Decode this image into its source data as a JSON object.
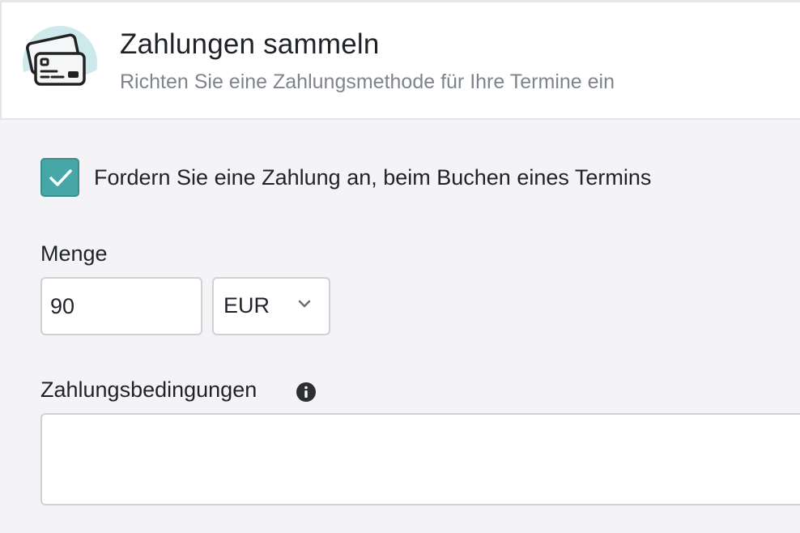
{
  "header": {
    "title": "Zahlungen sammeln",
    "subtitle": "Richten Sie eine Zahlungsmethode für Ihre Termine ein",
    "icon": "credit-cards-icon"
  },
  "payment_required": {
    "checked": true,
    "label": "Fordern Sie eine Zahlung an, beim Buchen eines Termins"
  },
  "amount": {
    "label": "Menge",
    "value": "90",
    "currency": "EUR"
  },
  "terms": {
    "label": "Zahlungsbedingungen",
    "value": "",
    "info_icon": "info-icon"
  },
  "colors": {
    "accent": "#47a7a6",
    "icon_bg": "#cde9ec",
    "background": "#f4f4f6"
  }
}
